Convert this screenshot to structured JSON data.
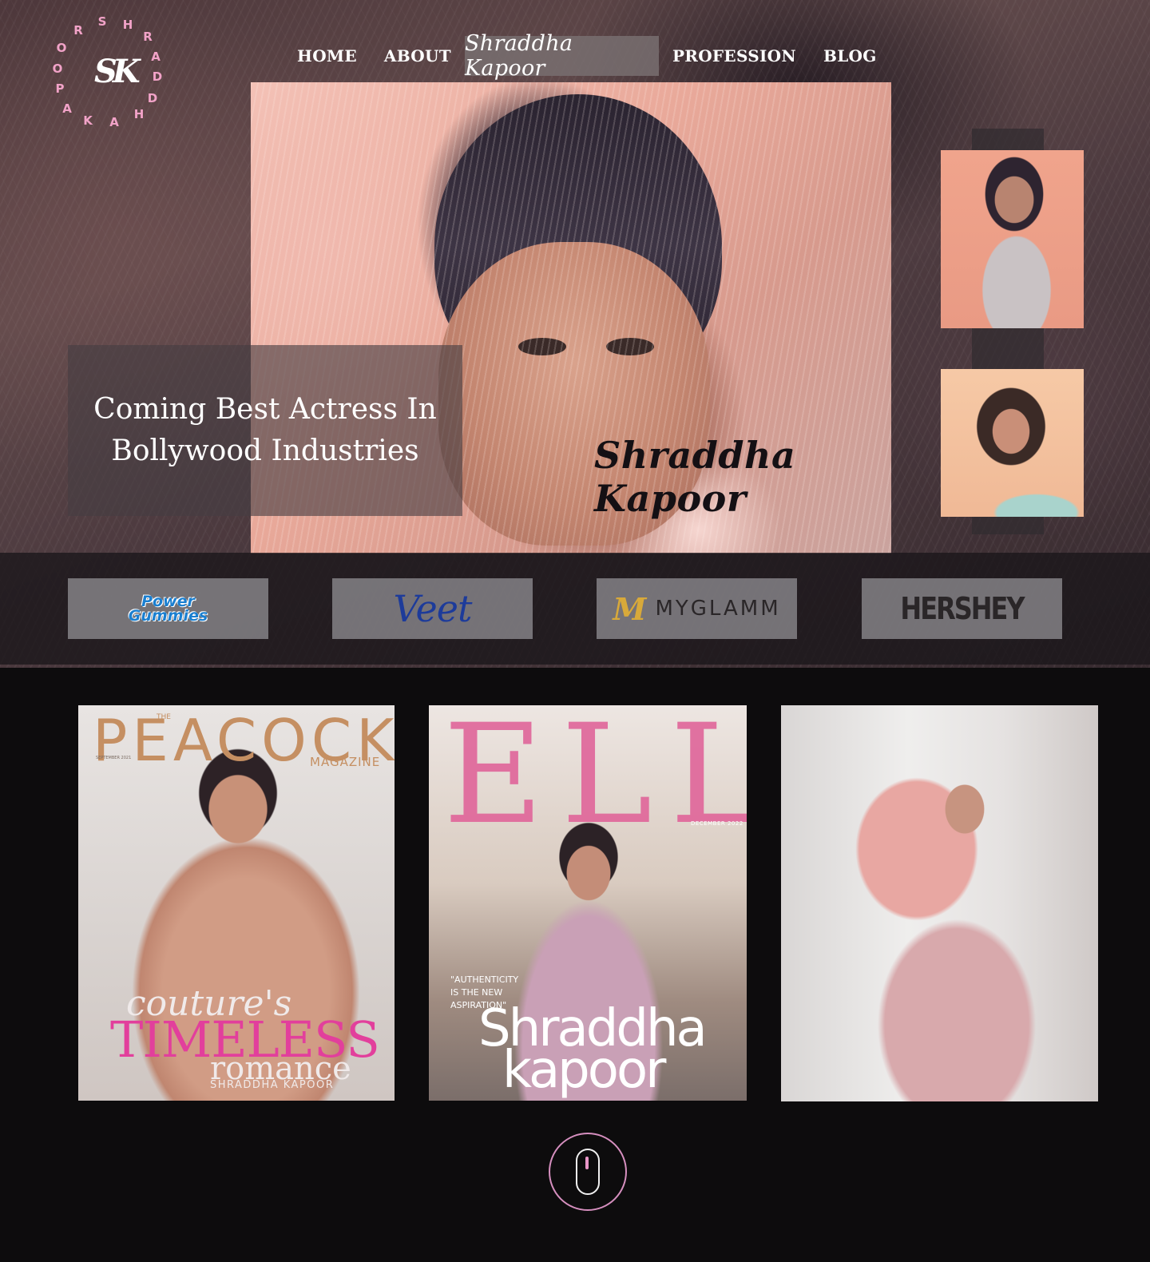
{
  "logo": {
    "mark": "SK",
    "ring_letters": [
      "S",
      "H",
      "R",
      "A",
      "D",
      "D",
      "H",
      "A",
      "K",
      "A",
      "P",
      "O",
      "O",
      "R"
    ],
    "ring_color": "#f2a3c8"
  },
  "nav": {
    "home": "HOME",
    "about": "ABOUT",
    "brand": "Shraddha Kapoor",
    "profession": "PROFESSION",
    "blog": "BLOG"
  },
  "hero": {
    "tagline_line1": "Coming Best Actress In",
    "tagline_line2": "Bollywood Industries",
    "signature": "Shraddha Kapoor"
  },
  "sponsors": {
    "power_gummies_line1": "Power",
    "power_gummies_line2": "Gummies",
    "veet": "Veet",
    "myglamm_mark": "M",
    "myglamm": "MYGLAMM",
    "hershey": "HERSHEY"
  },
  "covers": {
    "peacock": {
      "the": "THE",
      "title": "PEACOCK",
      "magazine": "MAGAZINE",
      "date": "SEPTEMBER 2021",
      "line1": "couture's",
      "line2": "TIMELESS",
      "line3": "romance",
      "name": "SHRADDHA KAPOOR"
    },
    "elle": {
      "title": "ELLE",
      "date": "DECEMBER 2022",
      "quote_line1": "\"AUTHENTICITY",
      "quote_line2": "IS THE NEW",
      "quote_line3": "ASPIRATION\"",
      "name_line1": "Shraddha",
      "name_line2": "kapoor"
    }
  },
  "colors": {
    "accent_pink": "#e996c8",
    "page_bg": "#0d0c0d"
  },
  "icons": {
    "scroll": "mouse-scroll-icon"
  }
}
